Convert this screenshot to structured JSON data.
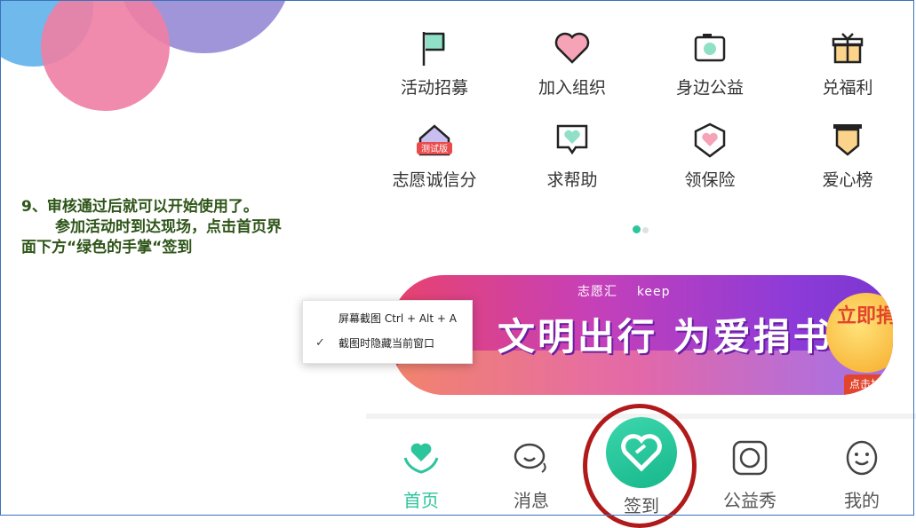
{
  "annotation": {
    "line1": "9、审核通过后就可以开始使用了。",
    "line2": "参加活动时到达现场，点击首页界面下方“绿色的手掌“签到"
  },
  "grid": [
    {
      "label": "活动招募",
      "icon": "flag-icon"
    },
    {
      "label": "加入组织",
      "icon": "heart-icon"
    },
    {
      "label": "身边公益",
      "icon": "camera-icon"
    },
    {
      "label": "兑福利",
      "icon": "gift-icon"
    },
    {
      "label": "志愿诚信分",
      "icon": "house-icon",
      "badge": "测试版"
    },
    {
      "label": "求帮助",
      "icon": "chat-heart-icon"
    },
    {
      "label": "领保险",
      "icon": "shield-heart-icon"
    },
    {
      "label": "爱心榜",
      "icon": "banner-ribbon-icon"
    }
  ],
  "banner": {
    "brand_left": "志愿汇",
    "brand_right": "keep",
    "slogan": "文明出行 为爱捐书",
    "cta": "立即捐",
    "draw": "点击抽奖"
  },
  "context_menu": {
    "item1": "屏幕截图 Ctrl + Alt + A",
    "item2": "截图时隐藏当前窗口"
  },
  "tabbar": {
    "home": "首页",
    "messages": "消息",
    "checkin": "签到",
    "showcase": "公益秀",
    "mine": "我的"
  },
  "colors": {
    "accent": "#2dc59c",
    "highlight_ring": "#b11a1a",
    "annotation_text": "#2e5518"
  }
}
